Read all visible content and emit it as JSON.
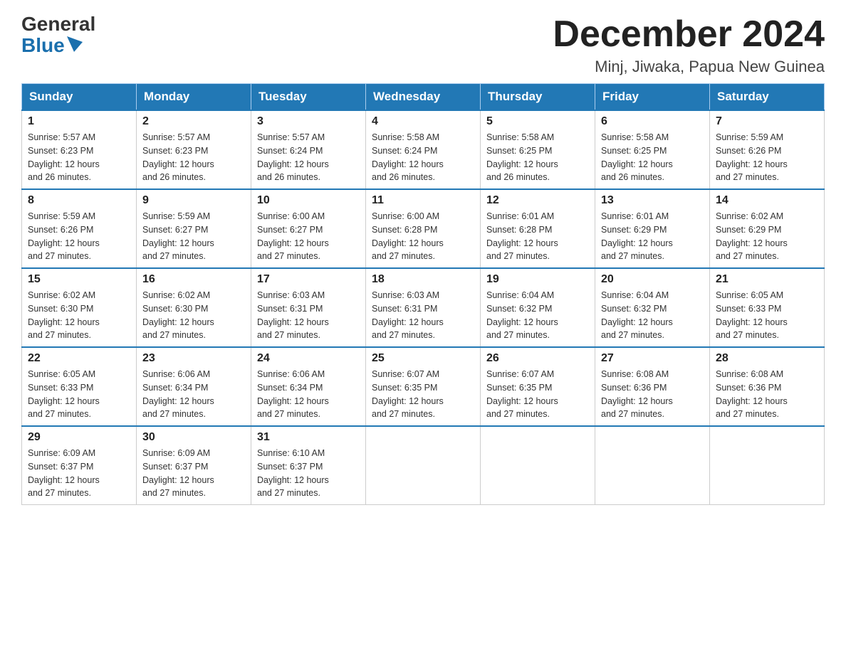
{
  "header": {
    "logo_general": "General",
    "logo_blue": "Blue",
    "title": "December 2024",
    "location": "Minj, Jiwaka, Papua New Guinea"
  },
  "weekdays": [
    "Sunday",
    "Monday",
    "Tuesday",
    "Wednesday",
    "Thursday",
    "Friday",
    "Saturday"
  ],
  "weeks": [
    [
      {
        "day": "1",
        "sunrise": "5:57 AM",
        "sunset": "6:23 PM",
        "daylight": "12 hours and 26 minutes."
      },
      {
        "day": "2",
        "sunrise": "5:57 AM",
        "sunset": "6:23 PM",
        "daylight": "12 hours and 26 minutes."
      },
      {
        "day": "3",
        "sunrise": "5:57 AM",
        "sunset": "6:24 PM",
        "daylight": "12 hours and 26 minutes."
      },
      {
        "day": "4",
        "sunrise": "5:58 AM",
        "sunset": "6:24 PM",
        "daylight": "12 hours and 26 minutes."
      },
      {
        "day": "5",
        "sunrise": "5:58 AM",
        "sunset": "6:25 PM",
        "daylight": "12 hours and 26 minutes."
      },
      {
        "day": "6",
        "sunrise": "5:58 AM",
        "sunset": "6:25 PM",
        "daylight": "12 hours and 26 minutes."
      },
      {
        "day": "7",
        "sunrise": "5:59 AM",
        "sunset": "6:26 PM",
        "daylight": "12 hours and 27 minutes."
      }
    ],
    [
      {
        "day": "8",
        "sunrise": "5:59 AM",
        "sunset": "6:26 PM",
        "daylight": "12 hours and 27 minutes."
      },
      {
        "day": "9",
        "sunrise": "5:59 AM",
        "sunset": "6:27 PM",
        "daylight": "12 hours and 27 minutes."
      },
      {
        "day": "10",
        "sunrise": "6:00 AM",
        "sunset": "6:27 PM",
        "daylight": "12 hours and 27 minutes."
      },
      {
        "day": "11",
        "sunrise": "6:00 AM",
        "sunset": "6:28 PM",
        "daylight": "12 hours and 27 minutes."
      },
      {
        "day": "12",
        "sunrise": "6:01 AM",
        "sunset": "6:28 PM",
        "daylight": "12 hours and 27 minutes."
      },
      {
        "day": "13",
        "sunrise": "6:01 AM",
        "sunset": "6:29 PM",
        "daylight": "12 hours and 27 minutes."
      },
      {
        "day": "14",
        "sunrise": "6:02 AM",
        "sunset": "6:29 PM",
        "daylight": "12 hours and 27 minutes."
      }
    ],
    [
      {
        "day": "15",
        "sunrise": "6:02 AM",
        "sunset": "6:30 PM",
        "daylight": "12 hours and 27 minutes."
      },
      {
        "day": "16",
        "sunrise": "6:02 AM",
        "sunset": "6:30 PM",
        "daylight": "12 hours and 27 minutes."
      },
      {
        "day": "17",
        "sunrise": "6:03 AM",
        "sunset": "6:31 PM",
        "daylight": "12 hours and 27 minutes."
      },
      {
        "day": "18",
        "sunrise": "6:03 AM",
        "sunset": "6:31 PM",
        "daylight": "12 hours and 27 minutes."
      },
      {
        "day": "19",
        "sunrise": "6:04 AM",
        "sunset": "6:32 PM",
        "daylight": "12 hours and 27 minutes."
      },
      {
        "day": "20",
        "sunrise": "6:04 AM",
        "sunset": "6:32 PM",
        "daylight": "12 hours and 27 minutes."
      },
      {
        "day": "21",
        "sunrise": "6:05 AM",
        "sunset": "6:33 PM",
        "daylight": "12 hours and 27 minutes."
      }
    ],
    [
      {
        "day": "22",
        "sunrise": "6:05 AM",
        "sunset": "6:33 PM",
        "daylight": "12 hours and 27 minutes."
      },
      {
        "day": "23",
        "sunrise": "6:06 AM",
        "sunset": "6:34 PM",
        "daylight": "12 hours and 27 minutes."
      },
      {
        "day": "24",
        "sunrise": "6:06 AM",
        "sunset": "6:34 PM",
        "daylight": "12 hours and 27 minutes."
      },
      {
        "day": "25",
        "sunrise": "6:07 AM",
        "sunset": "6:35 PM",
        "daylight": "12 hours and 27 minutes."
      },
      {
        "day": "26",
        "sunrise": "6:07 AM",
        "sunset": "6:35 PM",
        "daylight": "12 hours and 27 minutes."
      },
      {
        "day": "27",
        "sunrise": "6:08 AM",
        "sunset": "6:36 PM",
        "daylight": "12 hours and 27 minutes."
      },
      {
        "day": "28",
        "sunrise": "6:08 AM",
        "sunset": "6:36 PM",
        "daylight": "12 hours and 27 minutes."
      }
    ],
    [
      {
        "day": "29",
        "sunrise": "6:09 AM",
        "sunset": "6:37 PM",
        "daylight": "12 hours and 27 minutes."
      },
      {
        "day": "30",
        "sunrise": "6:09 AM",
        "sunset": "6:37 PM",
        "daylight": "12 hours and 27 minutes."
      },
      {
        "day": "31",
        "sunrise": "6:10 AM",
        "sunset": "6:37 PM",
        "daylight": "12 hours and 27 minutes."
      },
      null,
      null,
      null,
      null
    ]
  ],
  "labels": {
    "sunrise": "Sunrise:",
    "sunset": "Sunset:",
    "daylight": "Daylight:"
  }
}
